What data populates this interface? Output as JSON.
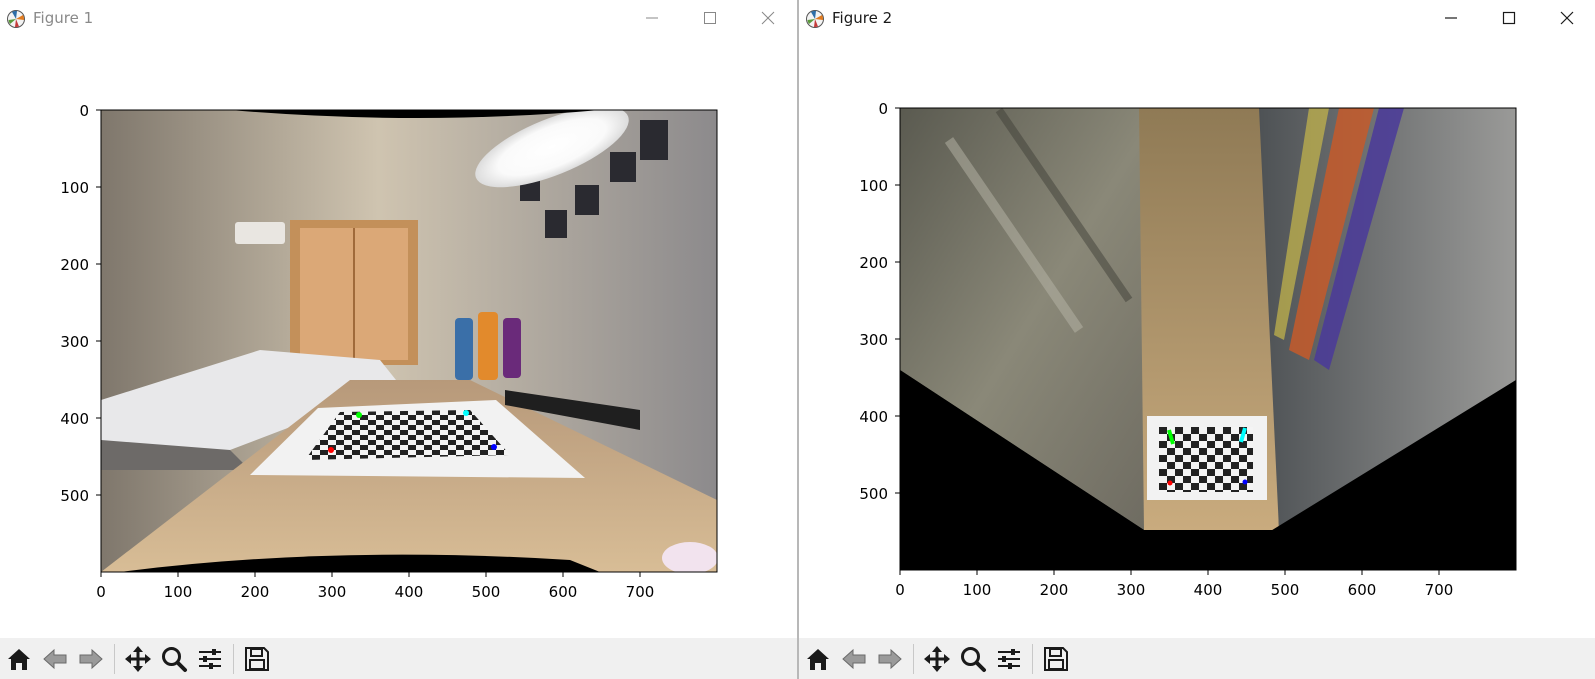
{
  "windows": [
    {
      "title": "Figure 1",
      "controls": {
        "minimize": "minimize-icon",
        "maximize": "maximize-icon",
        "close": "close-icon"
      },
      "axes": {
        "x_ticks": [
          "0",
          "100",
          "200",
          "300",
          "400",
          "500",
          "600",
          "700"
        ],
        "y_ticks": [
          "0",
          "100",
          "200",
          "300",
          "400",
          "500"
        ]
      },
      "image_content": "fisheye-room-photo-with-checkerboard",
      "marker_colors": [
        "#ff0000",
        "#00ff00",
        "#00ffff",
        "#0000ff"
      ]
    },
    {
      "title": "Figure 2",
      "controls": {
        "minimize": "minimize-icon",
        "maximize": "maximize-icon",
        "close": "close-icon"
      },
      "axes": {
        "x_ticks": [
          "0",
          "100",
          "200",
          "300",
          "400",
          "500",
          "600",
          "700"
        ],
        "y_ticks": [
          "0",
          "100",
          "200",
          "300",
          "400",
          "500"
        ]
      },
      "image_content": "birds-eye-warped-photo-with-checkerboard",
      "marker_colors": [
        "#ff0000",
        "#00ff00",
        "#00ffff",
        "#0000ff"
      ]
    }
  ],
  "toolbar": {
    "tools": [
      "home-icon",
      "back-arrow-icon",
      "forward-arrow-icon",
      "pan-move-icon",
      "zoom-magnifier-icon",
      "configure-subplots-icon",
      "save-floppy-icon"
    ]
  }
}
